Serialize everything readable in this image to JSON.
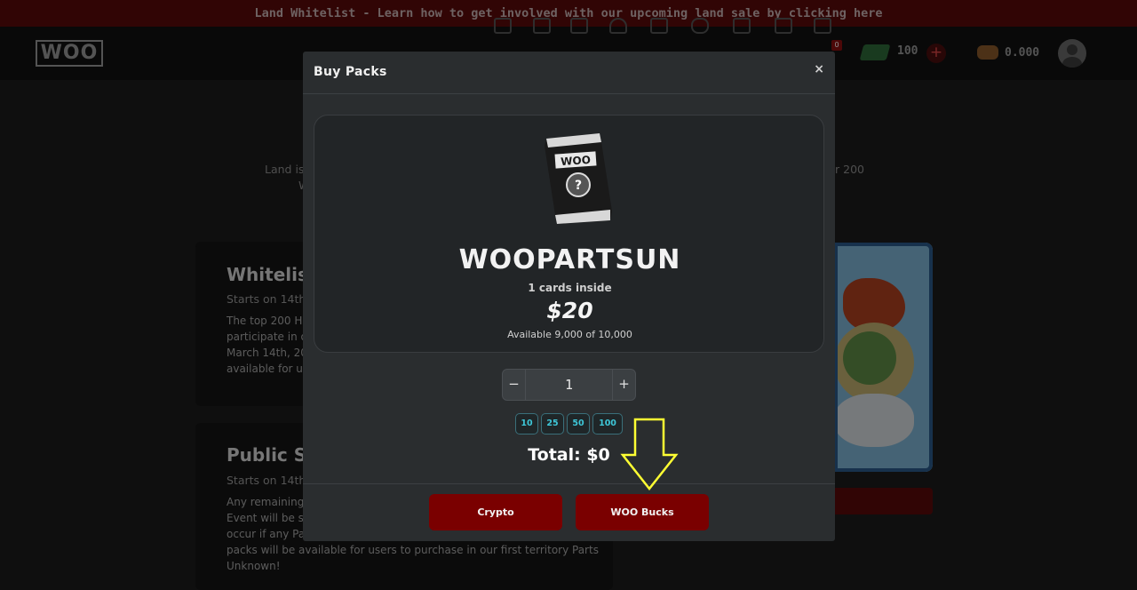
{
  "banner": {
    "text": "Land Whitelist - Learn how to get involved with our upcoming land sale by clicking here"
  },
  "nav": {
    "logo": "WOO",
    "icons": [
      "dice-icon",
      "cards-icon",
      "shop-icon",
      "helmet-icon",
      "market-icon",
      "pig-icon",
      "trade-icon",
      "wallet-icon",
      "cart-icon"
    ],
    "cart_count": "0",
    "woo_bucks": "100",
    "coin_balance": "0.000"
  },
  "background": {
    "intro_left": "Land is",
    "intro_left2": "W",
    "intro_right": "r 200",
    "whitelist": {
      "title": "Whitelis",
      "starts": "Starts on 14th",
      "lines": [
        "The top 200 HI",
        "participate in o",
        "March 14th, 20",
        "available for us"
      ]
    },
    "public": {
      "title": "Public S",
      "starts": "Starts on 14th",
      "lines": [
        "Any remaining",
        "Event will be so",
        "occur if any Pa",
        "packs will be available for users to purchase in our first territory Parts",
        "Unknown!"
      ]
    }
  },
  "modal": {
    "title": "Buy Packs",
    "close": "×",
    "pack": {
      "logo": "WOO",
      "name": "WOOPARTSUN",
      "cards_inside": "1 cards inside",
      "price": "$20",
      "availability": "Available 9,000 of 10,000"
    },
    "stepper": {
      "minus": "−",
      "value": "1",
      "plus": "+"
    },
    "quick_qty": [
      "10",
      "25",
      "50",
      "100"
    ],
    "total": "Total: $0",
    "buttons": {
      "crypto": "Crypto",
      "woo_bucks": "WOO Bucks"
    }
  },
  "colors": {
    "banner": "#5a0a0a",
    "pay_button": "#7a0000",
    "qty_accent": "#3ec7d8",
    "arrow": "#ffff33"
  }
}
